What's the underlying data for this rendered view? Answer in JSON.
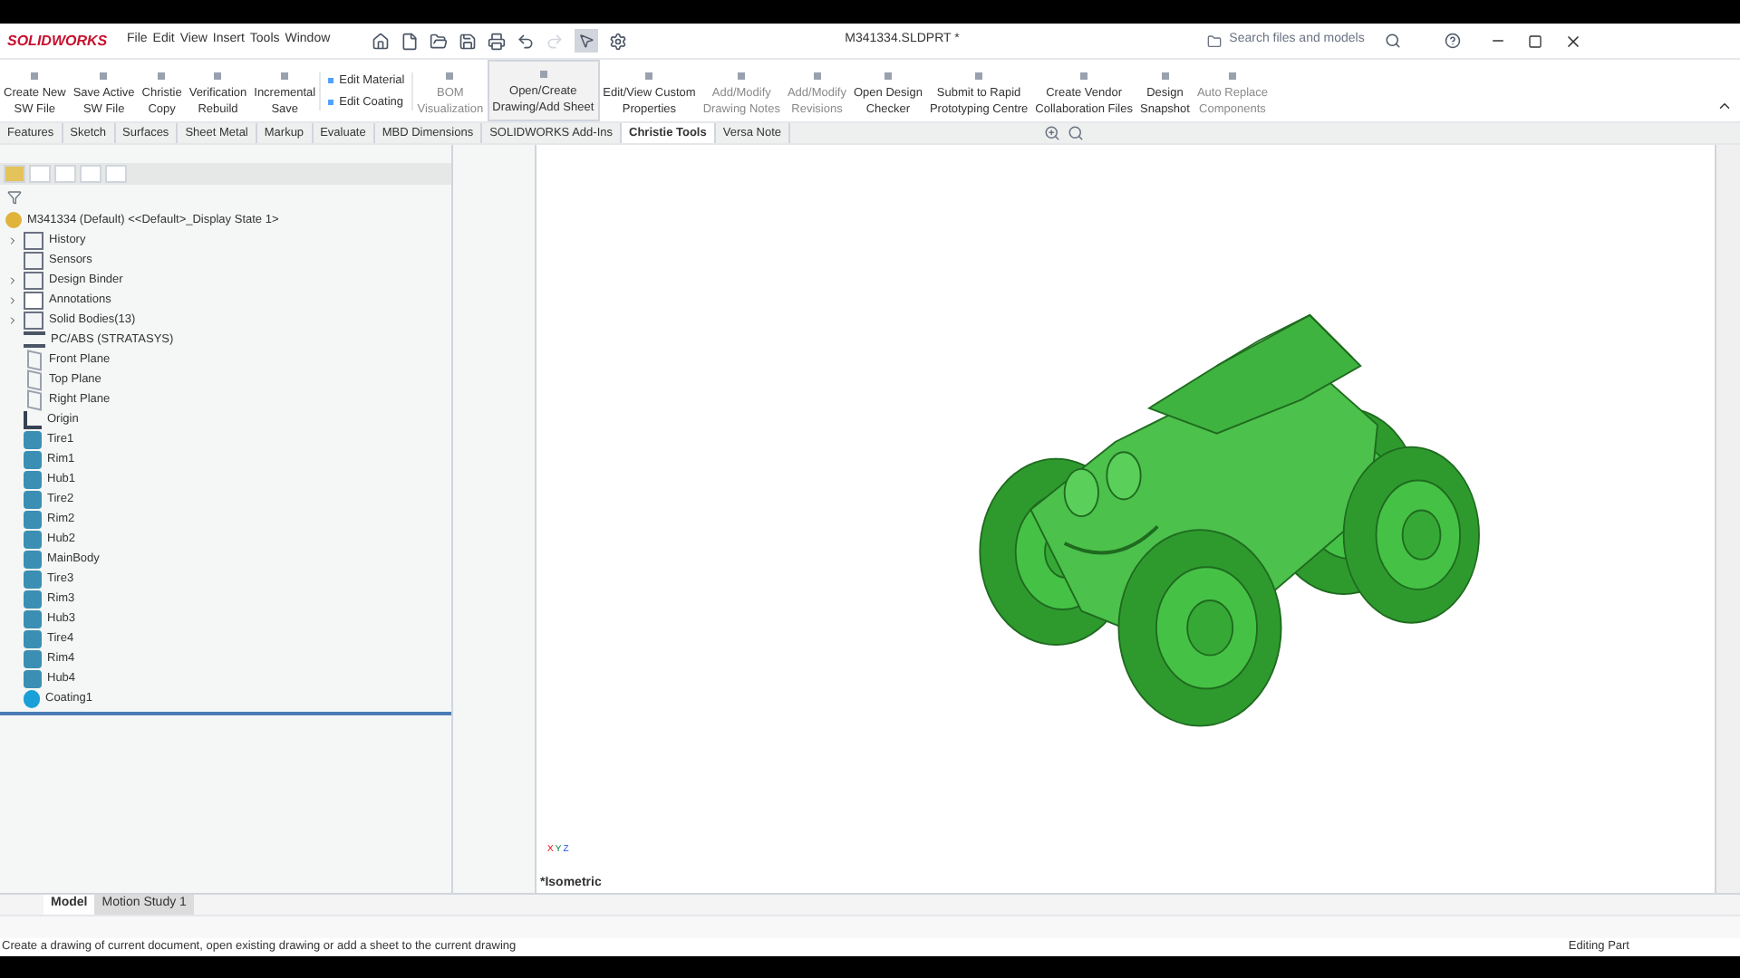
{
  "app": {
    "logo": "SOLIDWORKS",
    "menu": [
      "File",
      "Edit",
      "View",
      "Insert",
      "Tools",
      "Window"
    ],
    "document_title": "M341334.SLDPRT *",
    "search": {
      "placeholder": "Search files and models"
    }
  },
  "ribbon": [
    {
      "kind": "big",
      "lines": [
        "Create New",
        "SW File"
      ],
      "disabled": false,
      "hovered": false
    },
    {
      "kind": "big",
      "lines": [
        "Save Active",
        "SW File"
      ],
      "disabled": false,
      "hovered": false
    },
    {
      "kind": "big",
      "lines": [
        "Christie",
        "Copy"
      ],
      "disabled": false,
      "hovered": false
    },
    {
      "kind": "big",
      "lines": [
        "Verification",
        "Rebuild"
      ],
      "disabled": false,
      "hovered": false
    },
    {
      "kind": "big",
      "lines": [
        "Incremental",
        "Save"
      ],
      "disabled": false,
      "hovered": false
    },
    {
      "kind": "stack",
      "lines": [
        "Edit Material",
        "Edit Coating"
      ],
      "disabled": false,
      "hovered": false
    },
    {
      "kind": "big",
      "lines": [
        "BOM",
        "Visualization"
      ],
      "disabled": true,
      "hovered": false
    },
    {
      "kind": "big",
      "lines": [
        "Open/Create",
        "Drawing/Add Sheet"
      ],
      "disabled": false,
      "hovered": true
    },
    {
      "kind": "big",
      "lines": [
        "Edit/View Custom",
        "Properties"
      ],
      "disabled": false,
      "hovered": false
    },
    {
      "kind": "big",
      "lines": [
        "Add/Modify",
        "Drawing Notes"
      ],
      "disabled": true,
      "hovered": false
    },
    {
      "kind": "big",
      "lines": [
        "Add/Modify",
        "Revisions"
      ],
      "disabled": true,
      "hovered": false
    },
    {
      "kind": "big",
      "lines": [
        "Open Design",
        "Checker"
      ],
      "disabled": false,
      "hovered": false
    },
    {
      "kind": "big",
      "lines": [
        "Submit to Rapid",
        "Prototyping Centre"
      ],
      "disabled": false,
      "hovered": false
    },
    {
      "kind": "big",
      "lines": [
        "Create Vendor",
        "Collaboration Files"
      ],
      "disabled": false,
      "hovered": false
    },
    {
      "kind": "big",
      "lines": [
        "Design",
        "Snapshot"
      ],
      "disabled": false,
      "hovered": false
    },
    {
      "kind": "big",
      "lines": [
        "Auto Replace",
        "Components"
      ],
      "disabled": true,
      "hovered": false
    }
  ],
  "tabs": [
    {
      "label": "Features",
      "selected": false
    },
    {
      "label": "Sketch",
      "selected": false
    },
    {
      "label": "Surfaces",
      "selected": false
    },
    {
      "label": "Sheet Metal",
      "selected": false
    },
    {
      "label": "Markup",
      "selected": false
    },
    {
      "label": "Evaluate",
      "selected": false
    },
    {
      "label": "MBD Dimensions",
      "selected": false
    },
    {
      "label": "SOLIDWORKS Add-Ins",
      "selected": false
    },
    {
      "label": "Christie Tools",
      "selected": true
    },
    {
      "label": "Versa Note",
      "selected": false
    }
  ],
  "feature_tree": {
    "root": "M341334 (Default) <<Default>_Display State 1>",
    "items": [
      {
        "label": "History",
        "kind": "folder",
        "expandable": true
      },
      {
        "label": "Sensors",
        "kind": "folder",
        "expandable": false
      },
      {
        "label": "Design Binder",
        "kind": "folder",
        "expandable": true
      },
      {
        "label": "Annotations",
        "kind": "annotation",
        "expandable": true
      },
      {
        "label": "Solid Bodies(13)",
        "kind": "folder",
        "expandable": true
      },
      {
        "label": "PC/ABS (STRATASYS)",
        "kind": "material",
        "expandable": false
      },
      {
        "label": "Front Plane",
        "kind": "plane",
        "expandable": false
      },
      {
        "label": "Top Plane",
        "kind": "plane",
        "expandable": false
      },
      {
        "label": "Right Plane",
        "kind": "plane",
        "expandable": false
      },
      {
        "label": "Origin",
        "kind": "origin",
        "expandable": false
      },
      {
        "label": "Tire1",
        "kind": "body",
        "expandable": false
      },
      {
        "label": "Rim1",
        "kind": "body",
        "expandable": false
      },
      {
        "label": "Hub1",
        "kind": "body",
        "expandable": false
      },
      {
        "label": "Tire2",
        "kind": "body",
        "expandable": false
      },
      {
        "label": "Rim2",
        "kind": "body",
        "expandable": false
      },
      {
        "label": "Hub2",
        "kind": "body",
        "expandable": false
      },
      {
        "label": "MainBody",
        "kind": "body",
        "expandable": false
      },
      {
        "label": "Tire3",
        "kind": "body",
        "expandable": false
      },
      {
        "label": "Rim3",
        "kind": "body",
        "expandable": false
      },
      {
        "label": "Hub3",
        "kind": "body",
        "expandable": false
      },
      {
        "label": "Tire4",
        "kind": "body",
        "expandable": false
      },
      {
        "label": "Rim4",
        "kind": "body",
        "expandable": false
      },
      {
        "label": "Hub4",
        "kind": "body",
        "expandable": false
      },
      {
        "label": "Coating1",
        "kind": "coating",
        "expandable": false
      }
    ]
  },
  "viewport": {
    "view_name": "*Isometric",
    "triad": [
      "X",
      "Y",
      "Z"
    ]
  },
  "bottom_tabs": [
    {
      "label": "Model",
      "selected": true
    },
    {
      "label": "Motion Study 1",
      "selected": false
    }
  ],
  "status_bar": {
    "message": "Create a drawing of current document, open existing drawing or add a sheet to the current drawing",
    "mode": "Editing Part"
  }
}
